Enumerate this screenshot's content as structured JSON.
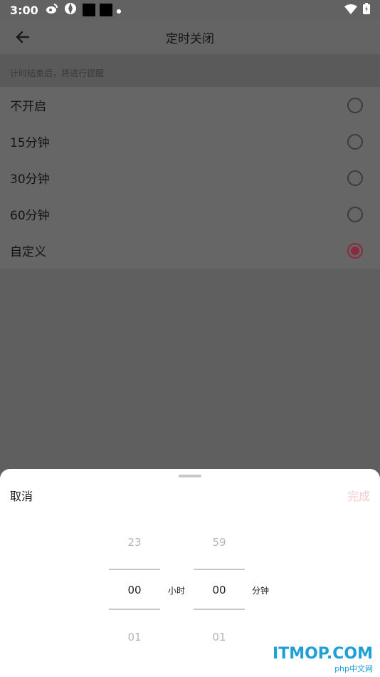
{
  "status_bar": {
    "time": "3:00"
  },
  "app_bar": {
    "title": "定时关闭"
  },
  "hint": "计时结束后，将进行提醒",
  "options": [
    {
      "label": "不开启",
      "selected": false
    },
    {
      "label": "15分钟",
      "selected": false
    },
    {
      "label": "30分钟",
      "selected": false
    },
    {
      "label": "60分钟",
      "selected": false
    },
    {
      "label": "自定义",
      "selected": true
    }
  ],
  "sheet": {
    "cancel_label": "取消",
    "done_label": "完成",
    "hour_wheel": {
      "prev": "23",
      "selected": "00",
      "next": "01",
      "unit": "小时"
    },
    "minute_wheel": {
      "prev": "59",
      "selected": "00",
      "next": "01",
      "unit": "分钟"
    }
  },
  "watermark": {
    "brand": "ITMOP.COM",
    "sub": "php中文网"
  },
  "colors": {
    "accent": "#8a2a3e",
    "done_disabled": "#f7c9cf",
    "scrim": "#5f5f5f"
  }
}
